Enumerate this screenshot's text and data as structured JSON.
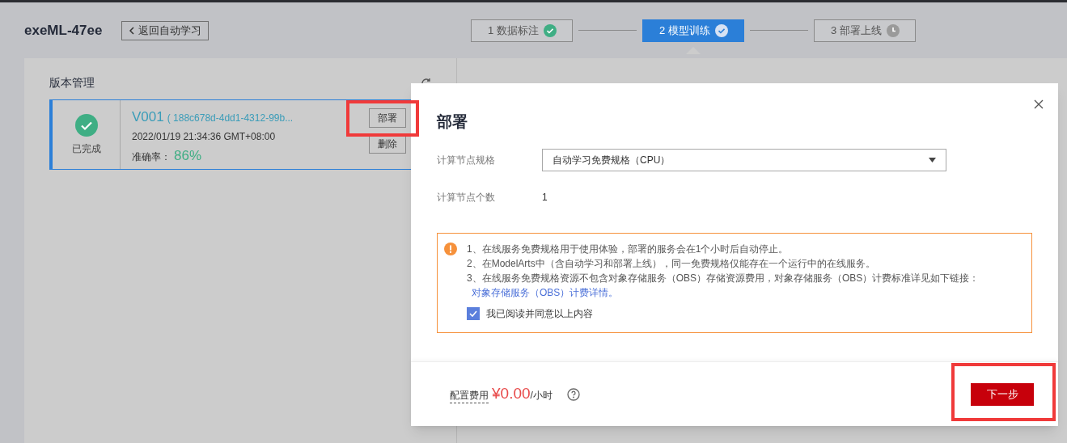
{
  "header": {
    "title": "exeML-47ee",
    "back_button": "返回自动学习"
  },
  "steps": [
    {
      "label": "1 数据标注",
      "selected": false,
      "kind": "done"
    },
    {
      "label": "2 模型训练",
      "selected": true,
      "kind": "done"
    },
    {
      "label": "3 部署上线",
      "selected": false,
      "kind": "pending"
    }
  ],
  "version_panel": {
    "title": "版本管理",
    "versions": [
      {
        "status": "已完成",
        "name": "V001",
        "id": "( 188c678d-4dd1-4312-99b...",
        "time": "2022/01/19 21:34:36 GMT+08:00",
        "accuracy_label": "准确率：",
        "accuracy": "86%",
        "actions": [
          "部署",
          "删除"
        ],
        "selected": true
      }
    ]
  },
  "dialog": {
    "title": "部署",
    "fields": [
      {
        "label": "计算节点规格",
        "kind": "select",
        "value": "自动学习免费规格（CPU）"
      },
      {
        "label": "计算节点个数",
        "kind": "text",
        "value": "1"
      }
    ],
    "notice": {
      "lines": [
        "1、在线服务免费规格用于使用体验，部署的服务会在1个小时后自动停止。",
        "2、在ModelArts中（含自动学习和部署上线），同一免费规格仅能存在一个运行中的在线服务。",
        "3、在线服务免费规格资源不包含对象存储服务（OBS）存储资源费用，对象存储服务（OBS）计费标准详见如下链接："
      ],
      "link": "对象存储服务（OBS）计费详情。",
      "agree": {
        "label": "我已阅读并同意以上内容",
        "checked": true
      }
    },
    "footer": {
      "cost_label": "配置费用",
      "price": "¥0.00",
      "unit": "/小时",
      "next_button": "下一步"
    }
  }
}
